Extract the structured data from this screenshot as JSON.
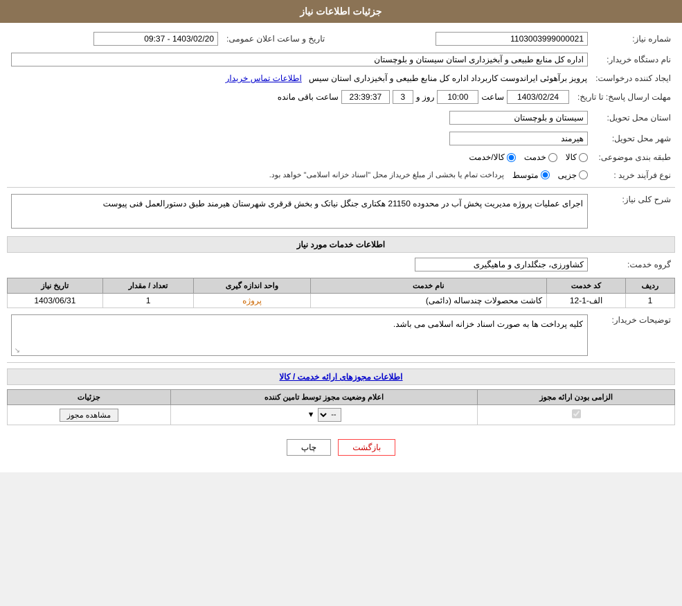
{
  "header": {
    "title": "جزئیات اطلاعات نیاز"
  },
  "fields": {
    "shomareNiaz_label": "شماره نیاز:",
    "shomareNiaz_value": "1103003999000021",
    "namDastgah_label": "نام دستگاه خریدار:",
    "namDastgah_value": "اداره کل منابع طبیعی و آبخیزداری استان سیستان و بلوچستان",
    "ijadKonande_label": "ایجاد کننده درخواست:",
    "ijadKonande_value": "پرویز برآهوئی ایراندوست کاربرداد اداره کل منابع طبیعی و آبخیزداری استان سیس",
    "ijadKonande_link": "اطلاعات تماس خریدار",
    "mohlat_label": "مهلت ارسال پاسخ: تا تاریخ:",
    "mohlat_date": "1403/02/24",
    "mohlat_saat_label": "ساعت",
    "mohlat_saat": "10:00",
    "mohlat_roz_label": "روز و",
    "mohlat_roz": "3",
    "mohlat_baqi": "23:39:37",
    "mohlat_baqi_label": "ساعت باقی مانده",
    "tarikh_label": "تاریخ و ساعت اعلان عمومی:",
    "tarikh_value": "1403/02/20 - 09:37",
    "ostan_label": "استان محل تحویل:",
    "ostan_value": "سیستان و بلوچستان",
    "shahr_label": "شهر محل تحویل:",
    "shahr_value": "هیرمند",
    "tabaqe_label": "طبقه بندی موضوعی:",
    "tabaqe_kala": "کالا",
    "tabaqe_khedmat": "خدمت",
    "tabaqe_kala_khedmat": "کالا/خدمت",
    "noeFarayand_label": "نوع فرآیند خرید :",
    "noeFarayand_jozi": "جزیی",
    "noeFarayand_motavasset": "متوسط",
    "noeFarayand_notice": "پرداخت تمام یا بخشی از مبلغ خریداز محل \"اسناد خزانه اسلامی\" خواهد بود.",
    "sharh_label": "شرح کلی نیاز:",
    "sharh_value": "اجرای عملیات پروژه مدیریت پخش آب در محدوده 21150 هکتاری جنگل نیاتک و بخش قرقری شهرستان هیرمند طبق دستورالعمل فنی پیوست",
    "khedmat_section": "اطلاعات خدمات مورد نیاز",
    "groheKhedmat_label": "گروه خدمت:",
    "groheKhedmat_value": "کشاورزی، جنگلداری و ماهیگیری",
    "table": {
      "headers": [
        "ردیف",
        "کد خدمت",
        "نام خدمت",
        "واحد اندازه گیری",
        "تعداد / مقدار",
        "تاریخ نیاز"
      ],
      "rows": [
        {
          "radif": "1",
          "kodKhedmat": "الف-1-12",
          "namKhedmat": "کاشت محصولات چندساله (دائمی)",
          "vahed": "پروژه",
          "tedad": "1",
          "tarikh": "1403/06/31"
        }
      ]
    },
    "tawzih_label": "توضیحات خریدار:",
    "tawzih_value": "کلیه پرداخت ها به صورت اسناد خزانه اسلامی می باشد.",
    "mojoz_section": "اطلاعات مجوزهای ارائه خدمت / کالا",
    "mojoz_table": {
      "headers": [
        "الزامی بودن ارائه مجوز",
        "اعلام وضعیت مجوز توسط تامین کننده",
        "جزئیات"
      ],
      "rows": [
        {
          "elzami": true,
          "eelam": "--",
          "joziat": "مشاهده مجوز"
        }
      ]
    }
  },
  "buttons": {
    "print": "چاپ",
    "back": "بازگشت"
  }
}
